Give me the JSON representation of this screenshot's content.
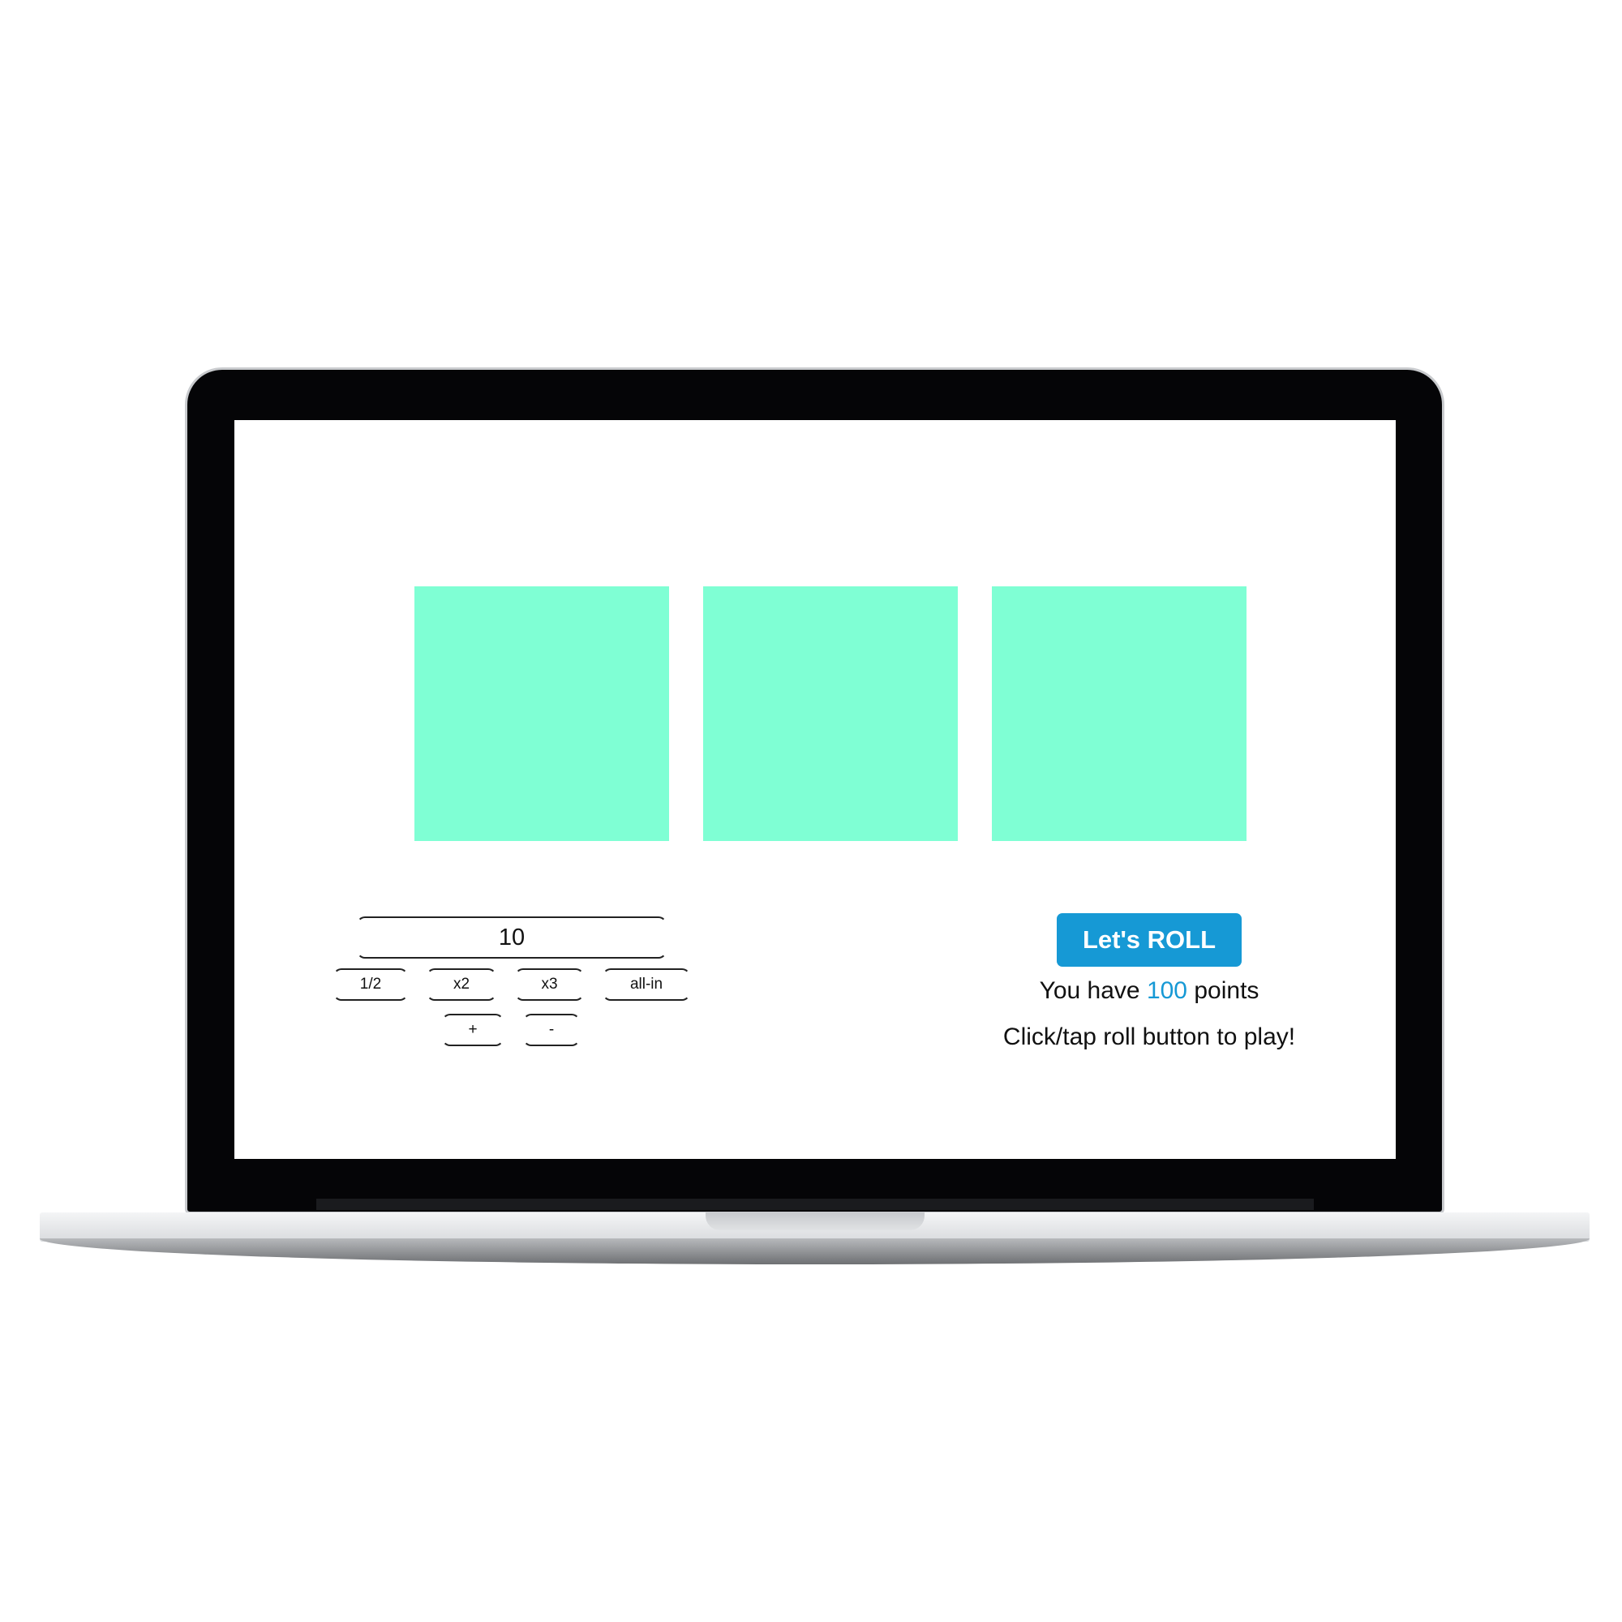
{
  "bet": {
    "value": "10",
    "buttons": {
      "half": "1/2",
      "double": "x2",
      "triple": "x3",
      "all_in": "all-in",
      "plus": "+",
      "minus": "-"
    }
  },
  "roll": {
    "label": "Let's ROLL"
  },
  "status": {
    "points_prefix": "You have",
    "points_value": "100",
    "points_suffix": "points",
    "hint": "Click/tap roll button to play!"
  },
  "colors": {
    "reel": "#7fffd4",
    "accent": "#1699d5"
  }
}
